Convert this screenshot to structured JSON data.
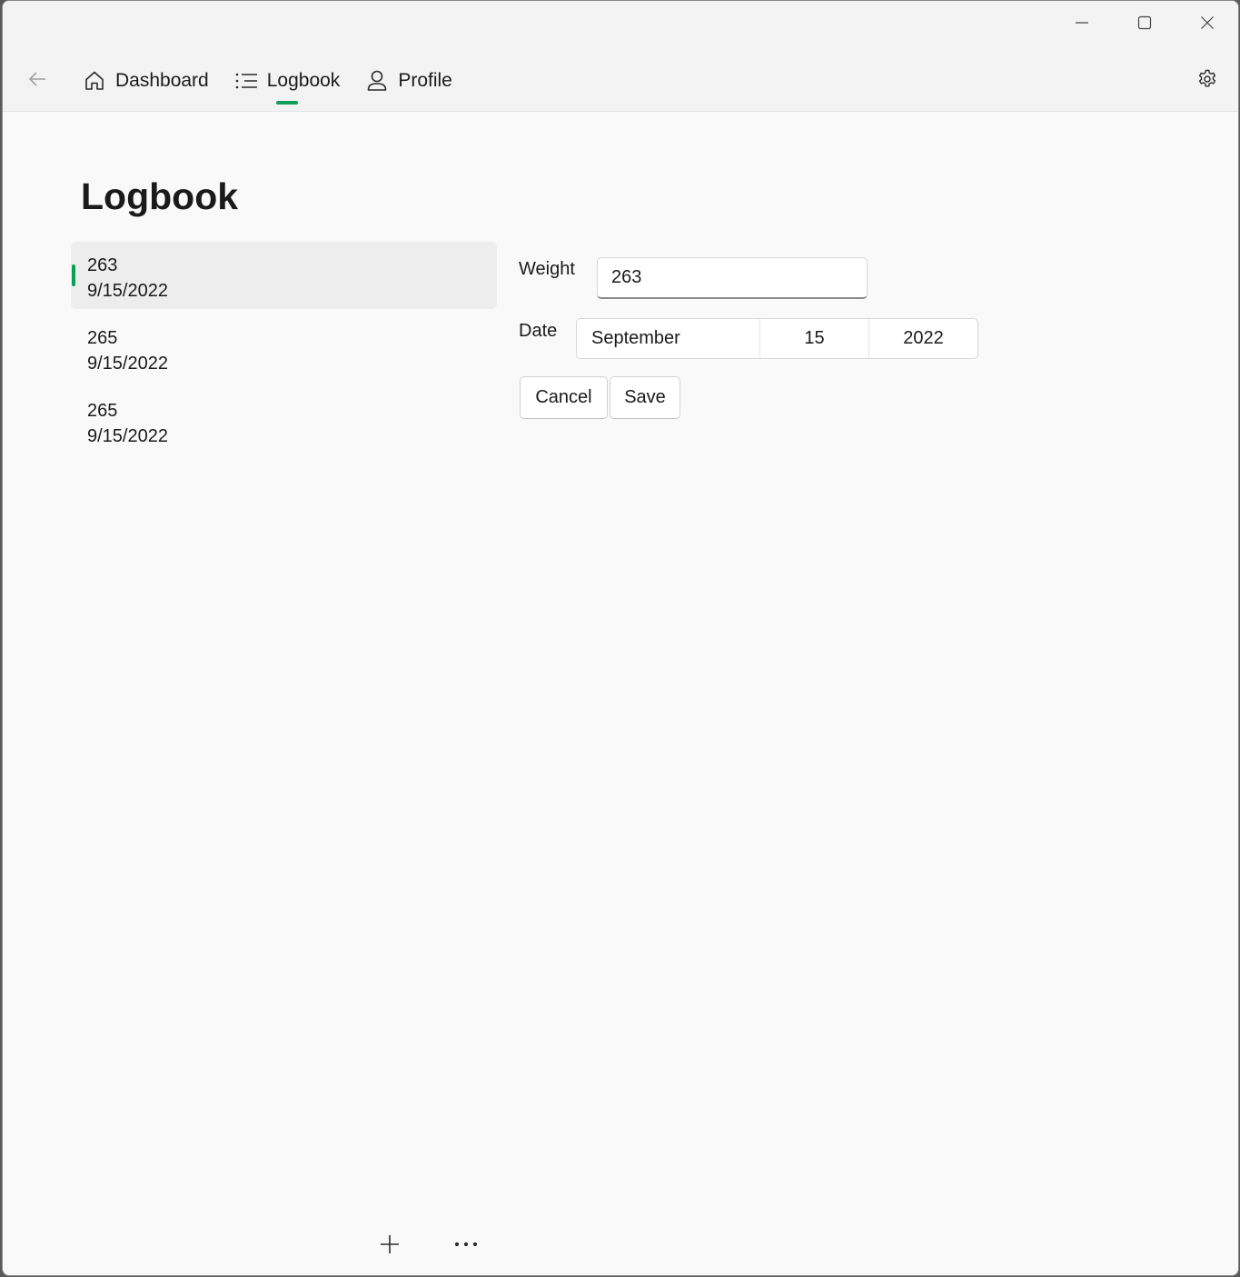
{
  "window": {
    "minimize_icon": "minimize-icon",
    "maximize_icon": "maximize-icon",
    "close_icon": "close-icon"
  },
  "nav": {
    "back_icon": "arrow-left-icon",
    "items": [
      {
        "label": "Dashboard",
        "icon": "home-icon",
        "selected": false
      },
      {
        "label": "Logbook",
        "icon": "list-icon",
        "selected": true
      },
      {
        "label": "Profile",
        "icon": "person-icon",
        "selected": false
      }
    ],
    "settings_icon": "gear-icon",
    "accent_color": "#0f9d58"
  },
  "page": {
    "title": "Logbook"
  },
  "entries": [
    {
      "weight": "263",
      "date": "9/15/2022",
      "selected": true
    },
    {
      "weight": "265",
      "date": "9/15/2022",
      "selected": false
    },
    {
      "weight": "265",
      "date": "9/15/2022",
      "selected": false
    }
  ],
  "form": {
    "weight_label": "Weight",
    "weight_value": "263",
    "date_label": "Date",
    "date_month": "September",
    "date_day": "15",
    "date_year": "2022",
    "cancel_label": "Cancel",
    "save_label": "Save"
  },
  "bottom_bar": {
    "add_icon": "plus-icon",
    "more_icon": "more-icon"
  }
}
